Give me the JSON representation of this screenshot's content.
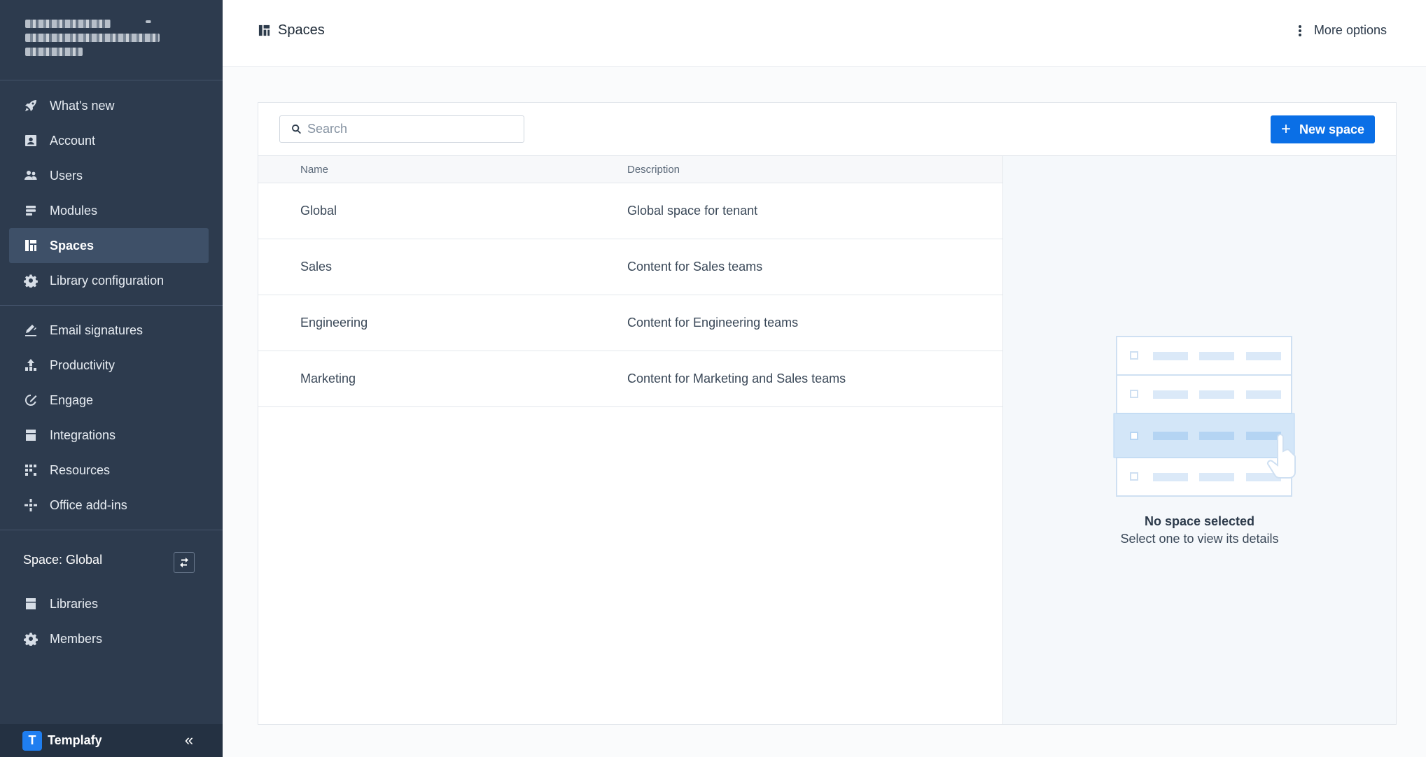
{
  "sidebar": {
    "nav_main": [
      {
        "label": "What's new",
        "icon": "rocket-icon"
      },
      {
        "label": "Account",
        "icon": "account-icon"
      },
      {
        "label": "Users",
        "icon": "users-icon"
      },
      {
        "label": "Modules",
        "icon": "modules-icon"
      },
      {
        "label": "Spaces",
        "icon": "spaces-icon",
        "active": true
      },
      {
        "label": "Library configuration",
        "icon": "gear-icon"
      }
    ],
    "nav_secondary": [
      {
        "label": "Email signatures",
        "icon": "signature-icon"
      },
      {
        "label": "Productivity",
        "icon": "productivity-icon"
      },
      {
        "label": "Engage",
        "icon": "engage-icon"
      },
      {
        "label": "Integrations",
        "icon": "integrations-icon"
      },
      {
        "label": "Resources",
        "icon": "resources-icon"
      },
      {
        "label": "Office add-ins",
        "icon": "add-ins-icon"
      }
    ],
    "space_label": "Space: Global",
    "nav_space": [
      {
        "label": "Libraries",
        "icon": "libraries-icon"
      },
      {
        "label": "Members",
        "icon": "gear-icon"
      }
    ],
    "brand": {
      "logo_letter": "T",
      "name": "Templafy"
    },
    "collapse_glyph": "«"
  },
  "header": {
    "title": "Spaces",
    "more_options": "More options"
  },
  "toolbar": {
    "search_placeholder": "Search",
    "new_space_label": "New space",
    "new_space_plus": "+"
  },
  "table": {
    "columns": {
      "name": "Name",
      "description": "Description"
    },
    "rows": [
      {
        "name": "Global",
        "description": "Global space for tenant"
      },
      {
        "name": "Sales",
        "description": "Content for Sales teams"
      },
      {
        "name": "Engineering",
        "description": "Content for Engineering teams"
      },
      {
        "name": "Marketing",
        "description": "Content for Marketing and Sales teams"
      }
    ]
  },
  "detail": {
    "empty_title": "No space selected",
    "empty_subtitle": "Select one to view its details"
  },
  "colors": {
    "sidebar_bg": "#2d3b4e",
    "primary": "#0a6fe6",
    "active_item": "#3e5068"
  }
}
